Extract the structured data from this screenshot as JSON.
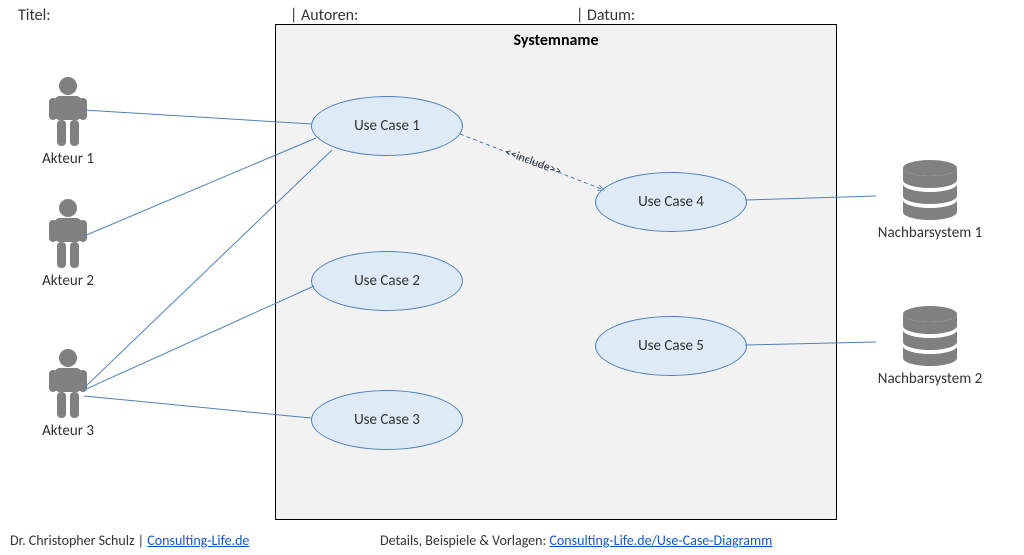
{
  "header": {
    "title_label": "Titel:",
    "authors_label": "| Autoren:",
    "date_label": "| Datum:"
  },
  "system": {
    "name": "Systemname"
  },
  "usecases": {
    "uc1": "Use Case 1",
    "uc2": "Use Case 2",
    "uc3": "Use Case 3",
    "uc4": "Use Case 4",
    "uc5": "Use Case 5"
  },
  "actors": {
    "a1": "Akteur 1",
    "a2": "Akteur 2",
    "a3": "Akteur 3"
  },
  "neighbors": {
    "n1": "Nachbarsystem 1",
    "n2": "Nachbarsystem 2"
  },
  "relations": {
    "include_label": "<<include>>"
  },
  "footer": {
    "author_prefix": "Dr. Christopher Schulz | ",
    "link1_text": "Consulting-Life.de",
    "details_prefix": "Details, Beispiele & Vorlagen: ",
    "link2_text": "Consulting-Life.de/Use-Case-Diagramm"
  },
  "colors": {
    "usecase_fill": "#deebf7",
    "usecase_border": "#4f81bd",
    "connector": "#4f81bd",
    "actor_gray": "#808080"
  }
}
